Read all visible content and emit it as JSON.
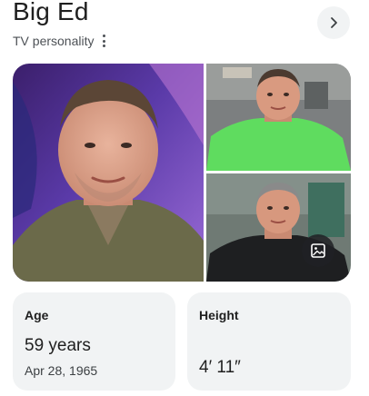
{
  "header": {
    "title": "Big Ed",
    "subtitle": "TV personality",
    "more_icon": "vertical-dots-icon",
    "next_icon": "chevron-right-icon"
  },
  "gallery": {
    "photos": [
      {
        "kind": "main-portrait"
      },
      {
        "kind": "green-shirt-portrait"
      },
      {
        "kind": "black-shirt-portrait"
      }
    ],
    "images_icon": "image-icon"
  },
  "facts": {
    "age": {
      "label": "Age",
      "value": "59 years",
      "sub": "Apr 28, 1965"
    },
    "height": {
      "label": "Height",
      "value": "4′ 11″"
    }
  },
  "colors": {
    "card_bg": "#f1f3f4",
    "text_primary": "#1f1f1f",
    "text_secondary": "#4d5156"
  }
}
